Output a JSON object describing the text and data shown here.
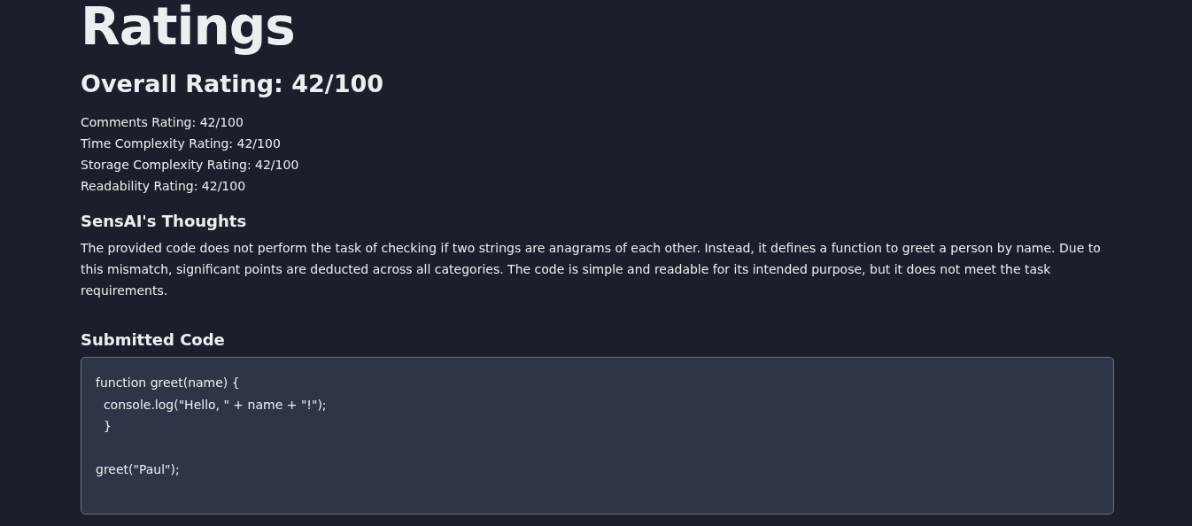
{
  "title": "Ratings",
  "overall": "Overall Rating: 42/100",
  "ratings": [
    "Comments Rating: 42/100",
    "Time Complexity Rating: 42/100",
    "Storage Complexity Rating: 42/100",
    "Readability Rating: 42/100"
  ],
  "thoughts": {
    "heading": "SensAI's Thoughts",
    "text": "The provided code does not perform the task of checking if two strings are anagrams of each other. Instead, it defines a function to greet a person by name. Due to this mismatch, significant points are deducted across all categories. The code is simple and readable for its intended purpose, but it does not meet the task requirements."
  },
  "submitted": {
    "heading": "Submitted Code",
    "code": "function greet(name) {\n  console.log(\"Hello, \" + name + \"!\");\n  }\n\ngreet(\"Paul\");"
  }
}
